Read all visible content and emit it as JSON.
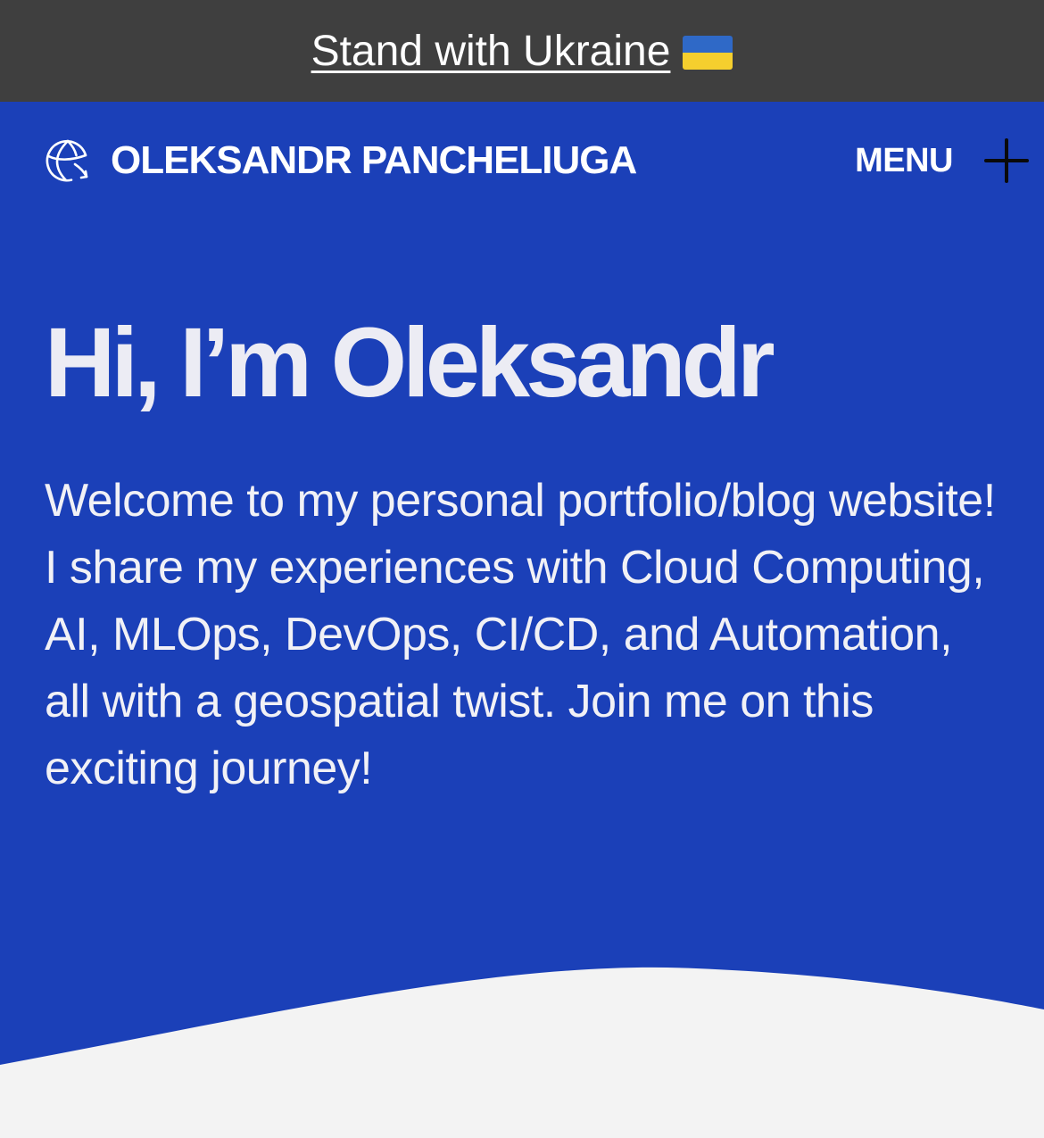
{
  "banner": {
    "label": "Stand with Ukraine",
    "flag_icon": "ukraine-flag-icon",
    "colors": {
      "background": "#3f3f3f",
      "flag_blue": "#2f69c7",
      "flag_yellow": "#f5cf2e"
    }
  },
  "header": {
    "logo_icon": "globe-icon",
    "site_name": "OLEKSANDR PANCHELIUGA",
    "menu_label": "MENU",
    "menu_icon": "plus-icon"
  },
  "hero": {
    "headline": "Hi, I’m Oleksandr",
    "intro": "Welcome to my personal portfolio/blog website! I share my experiences with Cloud Computing, AI, MLOps, DevOps, CI/CD, and Automation, all with a geospatial twist. Join me on this exciting journey!",
    "colors": {
      "background": "#1b40b8",
      "text": "#ececf4",
      "wave": "#f3f3f3"
    }
  }
}
